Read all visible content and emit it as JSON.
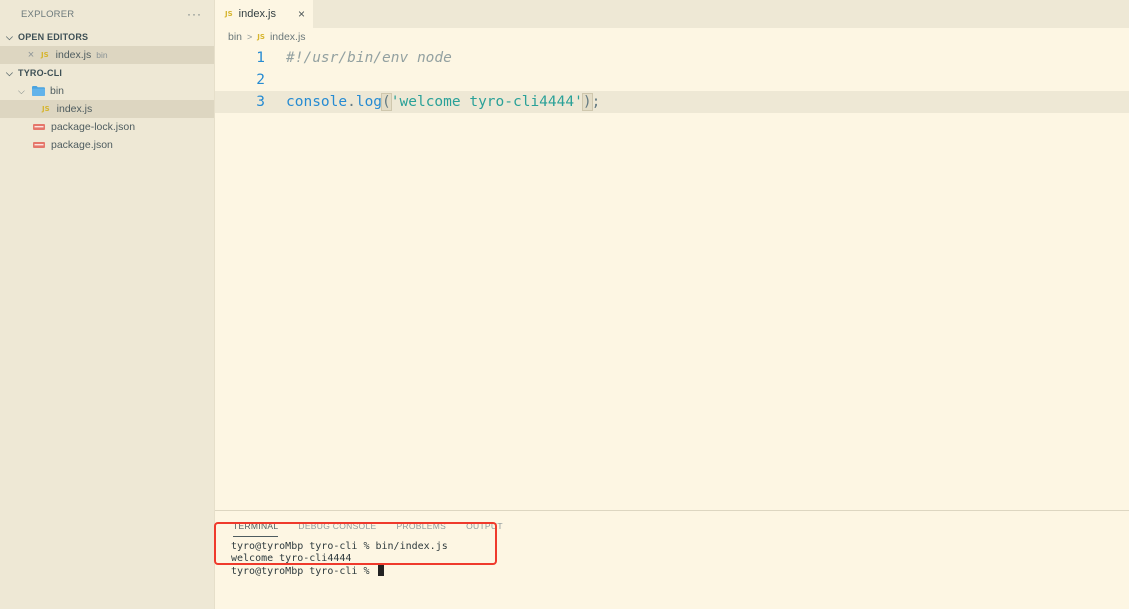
{
  "explorer": {
    "title": "EXPLORER",
    "more": "···",
    "open_editors": {
      "title": "OPEN EDITORS",
      "items": [
        {
          "icon": "JS",
          "name": "index.js",
          "path": "bin"
        }
      ]
    },
    "project": {
      "title": "TYRO-CLI",
      "folder": "bin",
      "children": [
        {
          "name": "index.js",
          "icon": "JS"
        }
      ],
      "files": [
        {
          "name": "package-lock.json"
        },
        {
          "name": "package.json"
        }
      ]
    }
  },
  "tab": {
    "icon": "JS",
    "label": "index.js",
    "close": "×"
  },
  "breadcrumb": {
    "folder": "bin",
    "separator": ">",
    "icon": "JS",
    "file": "index.js"
  },
  "editor": {
    "lines": [
      {
        "no": "1",
        "comment": "#!/usr/bin/env node"
      },
      {
        "no": "2"
      },
      {
        "no": "3",
        "obj": "console",
        "dot": ".",
        "method": "log",
        "open": "(",
        "string": "'welcome tyro-cli4444'",
        "close": ")",
        "semi": ";"
      }
    ]
  },
  "panel": {
    "tabs": [
      "TERMINAL",
      "DEBUG CONSOLE",
      "PROBLEMS",
      "OUTPUT"
    ],
    "terminal_lines": [
      "tyro@tyroMbp tyro-cli % bin/index.js",
      "welcome tyro-cli4444",
      "tyro@tyroMbp tyro-cli % "
    ]
  },
  "colors": {
    "accent_highlight": "#ef3a2c",
    "line_numbers": "#268bd2",
    "string": "#2aa198"
  }
}
